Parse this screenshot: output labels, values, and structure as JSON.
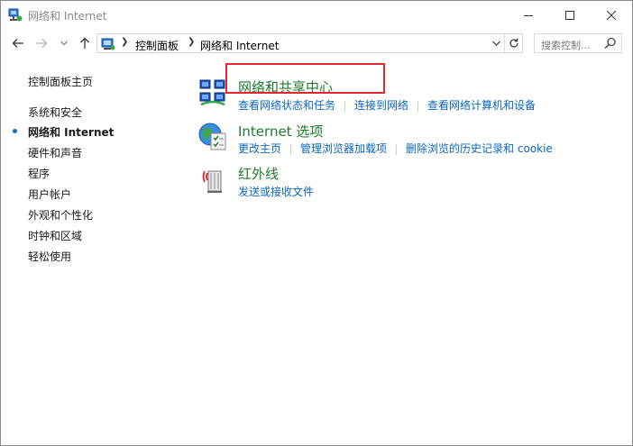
{
  "window": {
    "title": "网络和 Internet"
  },
  "breadcrumb": {
    "items": [
      "控制面板",
      "网络和 Internet"
    ]
  },
  "search": {
    "placeholder": "搜索控制..."
  },
  "sidebar": {
    "items": [
      {
        "label": "控制面板主页"
      },
      {
        "label": "系统和安全"
      },
      {
        "label": "网络和 Internet",
        "current": true
      },
      {
        "label": "硬件和声音"
      },
      {
        "label": "程序"
      },
      {
        "label": "用户帐户"
      },
      {
        "label": "外观和个性化"
      },
      {
        "label": "时钟和区域"
      },
      {
        "label": "轻松使用"
      }
    ]
  },
  "categories": [
    {
      "title": "网络和共享中心",
      "icon": "network-sharing-icon",
      "links": [
        "查看网络状态和任务",
        "连接到网络",
        "查看网络计算机和设备"
      ]
    },
    {
      "title": "Internet 选项",
      "icon": "internet-options-icon",
      "links": [
        "更改主页",
        "管理浏览器加载项",
        "删除浏览的历史记录和 cookie"
      ]
    },
    {
      "title": "红外线",
      "icon": "infrared-icon",
      "links": [
        "发送或接收文件"
      ]
    }
  ],
  "colors": {
    "link": "#0a66c2",
    "category_title": "#1e7b2c",
    "highlight": "#e3262f",
    "current_marker": "#1e6fc4"
  }
}
